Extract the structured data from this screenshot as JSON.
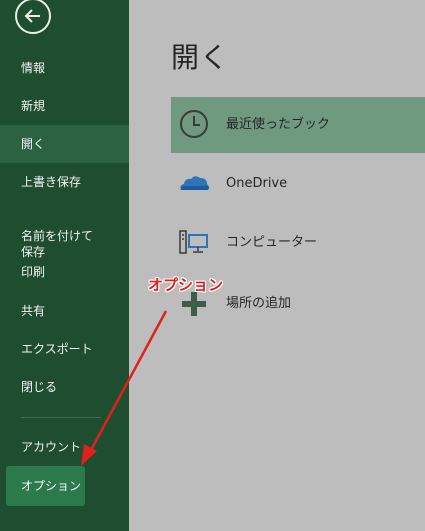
{
  "sidebar": {
    "items": [
      {
        "label": "情報"
      },
      {
        "label": "新規"
      },
      {
        "label": "開く"
      },
      {
        "label": "上書き保存"
      },
      {
        "label": "名前を付けて\n保存"
      },
      {
        "label": "印刷"
      },
      {
        "label": "共有"
      },
      {
        "label": "エクスポート"
      },
      {
        "label": "閉じる"
      },
      {
        "label": "アカウント"
      },
      {
        "label": "オプション"
      }
    ]
  },
  "main": {
    "title": "開く",
    "locations": [
      {
        "label": "最近使ったブック",
        "icon": "clock-icon"
      },
      {
        "label": "OneDrive",
        "icon": "onedrive-cloud-icon"
      },
      {
        "label": "コンピューター",
        "icon": "computer-icon"
      },
      {
        "label": "場所の追加",
        "icon": "plus-icon"
      }
    ]
  },
  "annotation": {
    "callout_text": "オプション"
  },
  "colors": {
    "sidebar_bg": "#1e4e2f",
    "sidebar_active": "#2c6142",
    "options_highlight": "#2b7a4b",
    "main_bg": "#bdbdbd",
    "recent_highlight": "#6f9a80",
    "annotation_red": "#e0201b"
  }
}
